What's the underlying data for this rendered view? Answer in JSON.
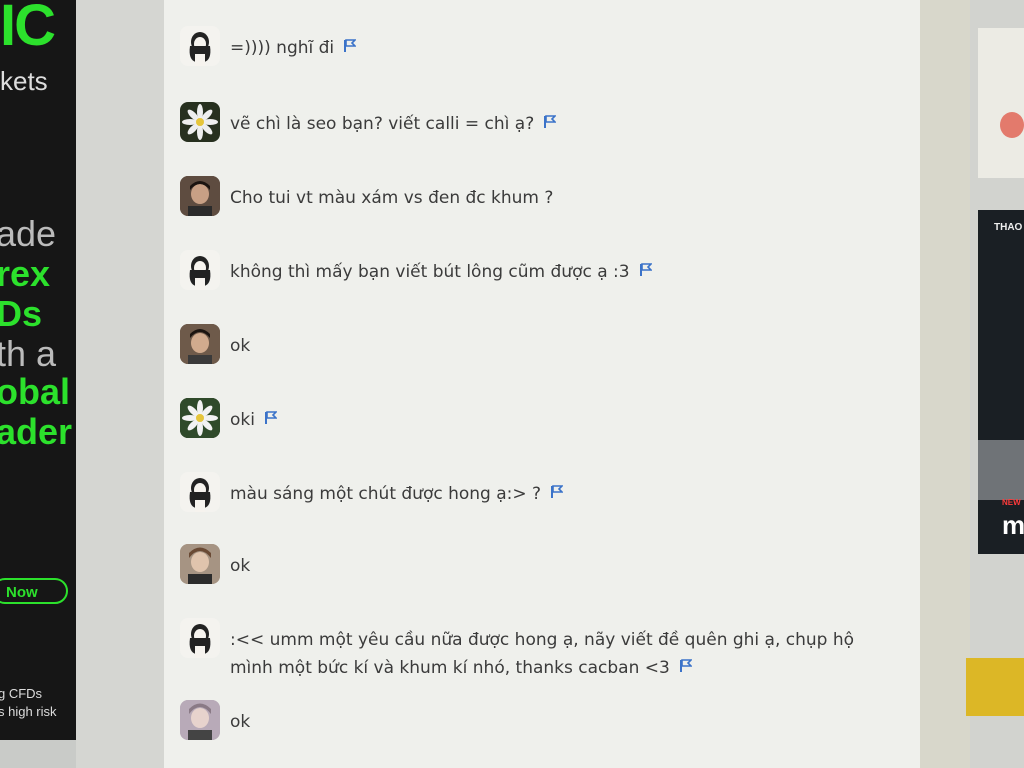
{
  "left_ad": {
    "brand_fragment": "IC",
    "sub_fragment": "kets",
    "lines": [
      "ade",
      "rex",
      "Ds",
      "th a",
      "obal",
      "ader"
    ],
    "cta_label": "Now",
    "fine_print_1": "g CFDs",
    "fine_print_2": "s high risk"
  },
  "messages": [
    {
      "text": "=)))) nghĩ đi",
      "avatar": "girl",
      "flag": true
    },
    {
      "text": "vẽ chì là seo bạn? viết calli = chì ạ?",
      "avatar": "flower",
      "flag": true
    },
    {
      "text": "Cho tui vt màu xám vs đen đc khum ?",
      "avatar": "boy",
      "flag": false
    },
    {
      "text": "không thì mấy bạn viết bút lông cũm được ạ :3",
      "avatar": "girl",
      "flag": true
    },
    {
      "text": "ok",
      "avatar": "boy",
      "flag": false
    },
    {
      "text": "oki",
      "avatar": "flower",
      "flag": true
    },
    {
      "text": "màu sáng một chút được hong ạ:> ?",
      "avatar": "girl",
      "flag": true
    },
    {
      "text": "ok",
      "avatar": "boy2",
      "flag": false
    },
    {
      "text": ":<< umm một yêu cầu nữa được hong ạ, nãy viết đề quên ghi ạ, chụp hộ mình một bức kí và khum kí nhó, thanks cacban <3",
      "avatar": "girl",
      "flag": true
    },
    {
      "text": "ok",
      "avatar": "boy3",
      "flag": false
    }
  ],
  "right_ad": {
    "label_top": "THAO",
    "label_new": "NEW",
    "label_m": "m"
  },
  "colors": {
    "ad_green": "#2ce12c",
    "flag_blue": "#3b73c9",
    "chat_bg": "#eff0ec"
  }
}
